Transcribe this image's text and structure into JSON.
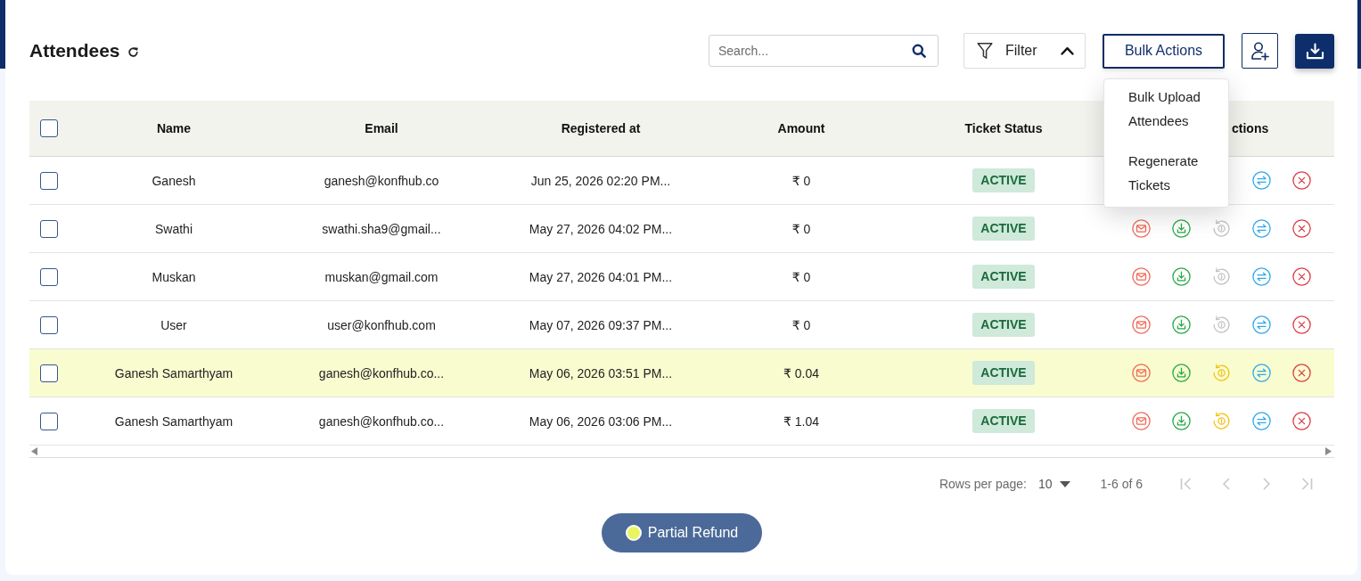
{
  "page": {
    "title": "Attendees"
  },
  "toolbar": {
    "search": {
      "placeholder": "Search..."
    },
    "filter": {
      "label": "Filter",
      "expanded": true
    },
    "bulk_actions": {
      "label": "Bulk Actions",
      "open": true,
      "menu": [
        "Bulk Upload Attendees",
        "Regenerate Tickets"
      ]
    }
  },
  "table": {
    "select_all_checked": false,
    "columns": [
      "Name",
      "Email",
      "Registered at",
      "Amount",
      "Ticket Status",
      "ctions"
    ],
    "rows": [
      {
        "checked": false,
        "partial_refund": false,
        "name": "Ganesh",
        "email": "ganesh@konfhub.co",
        "registered_at": "Jun 25, 2026 02:20 PM...",
        "amount": "₹ 0",
        "ticket_status": "ACTIVE",
        "actions": [
          {
            "kind": "transfer",
            "disabled": false
          },
          {
            "kind": "cancel",
            "disabled": false
          }
        ]
      },
      {
        "checked": false,
        "partial_refund": false,
        "name": "Swathi",
        "email": "swathi.sha9@gmail...",
        "registered_at": "May 27, 2026 04:02 PM...",
        "amount": "₹ 0",
        "ticket_status": "ACTIVE",
        "actions": [
          {
            "kind": "email",
            "disabled": false
          },
          {
            "kind": "download",
            "disabled": false
          },
          {
            "kind": "refund",
            "disabled": true
          },
          {
            "kind": "transfer",
            "disabled": false
          },
          {
            "kind": "cancel",
            "disabled": false
          }
        ]
      },
      {
        "checked": false,
        "partial_refund": false,
        "name": "Muskan",
        "email": "muskan@gmail.com",
        "registered_at": "May 27, 2026 04:01 PM...",
        "amount": "₹ 0",
        "ticket_status": "ACTIVE",
        "actions": [
          {
            "kind": "email",
            "disabled": false
          },
          {
            "kind": "download",
            "disabled": false
          },
          {
            "kind": "refund",
            "disabled": true
          },
          {
            "kind": "transfer",
            "disabled": false
          },
          {
            "kind": "cancel",
            "disabled": false
          }
        ]
      },
      {
        "checked": false,
        "partial_refund": false,
        "name": "User",
        "email": "user@konfhub.com",
        "registered_at": "May 07, 2026 09:37 PM...",
        "amount": "₹ 0",
        "ticket_status": "ACTIVE",
        "actions": [
          {
            "kind": "email",
            "disabled": false
          },
          {
            "kind": "download",
            "disabled": false
          },
          {
            "kind": "refund",
            "disabled": true
          },
          {
            "kind": "transfer",
            "disabled": false
          },
          {
            "kind": "cancel",
            "disabled": false
          }
        ]
      },
      {
        "checked": false,
        "partial_refund": true,
        "name": "Ganesh Samarthyam",
        "email": "ganesh@konfhub.co...",
        "registered_at": "May 06, 2026 03:51 PM...",
        "amount": "₹ 0.04",
        "ticket_status": "ACTIVE",
        "actions": [
          {
            "kind": "email",
            "disabled": false
          },
          {
            "kind": "download",
            "disabled": false
          },
          {
            "kind": "refund",
            "disabled": false
          },
          {
            "kind": "transfer",
            "disabled": false
          },
          {
            "kind": "cancel",
            "disabled": false
          }
        ]
      },
      {
        "checked": false,
        "partial_refund": false,
        "name": "Ganesh Samarthyam",
        "email": "ganesh@konfhub.co...",
        "registered_at": "May 06, 2026 03:06 PM...",
        "amount": "₹ 1.04",
        "ticket_status": "ACTIVE",
        "actions": [
          {
            "kind": "email",
            "disabled": false
          },
          {
            "kind": "download",
            "disabled": false
          },
          {
            "kind": "refund",
            "disabled": false
          },
          {
            "kind": "transfer",
            "disabled": false
          },
          {
            "kind": "cancel",
            "disabled": false
          }
        ]
      }
    ]
  },
  "pagination": {
    "rows_per_page_label": "Rows per page:",
    "rows_per_page": "10",
    "range": "1-6 of 6",
    "buttons": [
      {
        "kind": "first",
        "disabled": true
      },
      {
        "kind": "previous",
        "disabled": true
      },
      {
        "kind": "next",
        "disabled": true
      },
      {
        "kind": "last",
        "disabled": true
      }
    ]
  },
  "legend": {
    "label": "Partial Refund",
    "color": "#e9f55f"
  }
}
